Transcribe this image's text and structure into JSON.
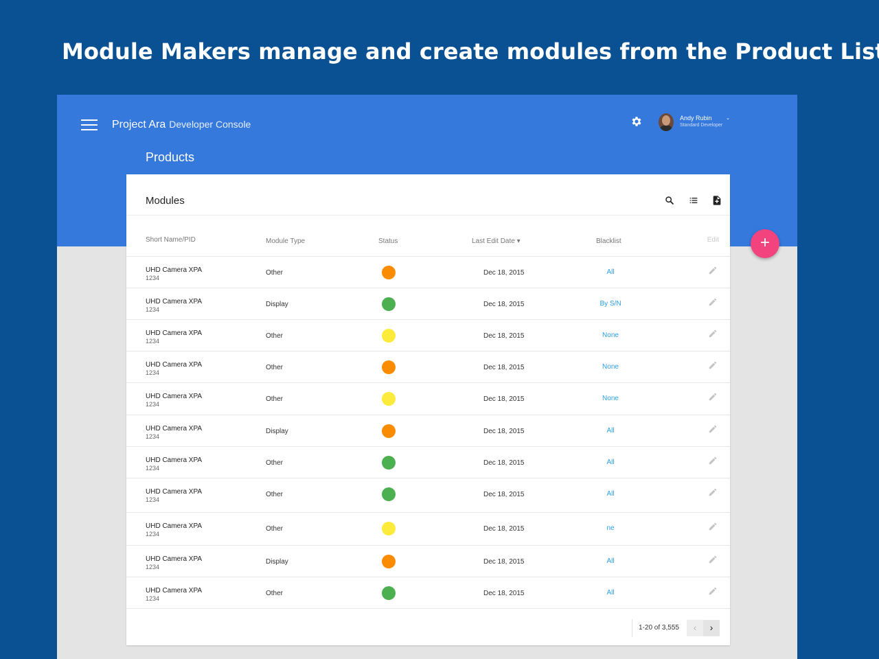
{
  "headline": "Module Makers manage and create modules from the Product List",
  "colors": {
    "page_bg": "#0a5194",
    "app_bar": "#3579dd",
    "fab": "#f3437f",
    "link": "#2a9ee2",
    "status_orange": "#fb8c00",
    "status_green": "#4caf50",
    "status_yellow": "#fdeb3b"
  },
  "app": {
    "menu_icon": "hamburger-icon",
    "brand_name": "Project Ara",
    "brand_sub": "Developer Console",
    "settings_icon": "gear-icon",
    "user": {
      "name": "Andy Rubin",
      "role": "Standard Developer",
      "caret_icon": "chevron-down-icon"
    },
    "page_title": "Products"
  },
  "card": {
    "title": "Modules",
    "tools": [
      "search-icon",
      "list-icon",
      "add-document-icon"
    ]
  },
  "table": {
    "headers": {
      "name": "Short Name/PID",
      "type": "Module Type",
      "status": "Status",
      "date": "Last Edit Date ▾",
      "blacklist": "Blacklist",
      "edit": "Edit"
    },
    "rows": [
      {
        "name": "UHD Camera XPA",
        "pid": "1234",
        "type": "Other",
        "status": "orange",
        "date": "Dec 18, 2015",
        "blacklist": "All"
      },
      {
        "name": "UHD Camera XPA",
        "pid": "1234",
        "type": "Display",
        "status": "green",
        "date": "Dec 18, 2015",
        "blacklist": "By S/N"
      },
      {
        "name": "UHD Camera XPA",
        "pid": "1234",
        "type": "Other",
        "status": "yellow",
        "date": "Dec 18, 2015",
        "blacklist": "None"
      },
      {
        "name": "UHD Camera XPA",
        "pid": "1234",
        "type": "Other",
        "status": "orange",
        "date": "Dec 18, 2015",
        "blacklist": "None"
      },
      {
        "name": "UHD Camera XPA",
        "pid": "1234",
        "type": "Other",
        "status": "yellow",
        "date": "Dec 18, 2015",
        "blacklist": "None"
      },
      {
        "name": "UHD Camera XPA",
        "pid": "1234",
        "type": "Display",
        "status": "orange",
        "date": "Dec 18, 2015",
        "blacklist": "All"
      },
      {
        "name": "UHD Camera XPA",
        "pid": "1234",
        "type": "Other",
        "status": "green",
        "date": "Dec 18, 2015",
        "blacklist": "All"
      },
      {
        "name": "UHD Camera XPA",
        "pid": "1234",
        "type": "Other",
        "status": "green",
        "date": "Dec 18, 2015",
        "blacklist": "All"
      },
      {
        "name": "UHD Camera XPA",
        "pid": "1234",
        "type": "Other",
        "status": "yellow",
        "date": "Dec 18, 2015",
        "blacklist": "ne"
      },
      {
        "name": "UHD Camera XPA",
        "pid": "1234",
        "type": "Display",
        "status": "orange",
        "date": "Dec 18, 2015",
        "blacklist": "All"
      },
      {
        "name": "UHD Camera XPA",
        "pid": "1234",
        "type": "Other",
        "status": "green",
        "date": "Dec 18, 2015",
        "blacklist": "All"
      }
    ]
  },
  "pagination": {
    "range": "1-20 of 3,555",
    "prev_icon": "chevron-left-icon",
    "next_icon": "chevron-right-icon",
    "prev_label": "‹",
    "next_label": "›"
  },
  "fab": {
    "label": "+",
    "icon": "plus-icon"
  }
}
